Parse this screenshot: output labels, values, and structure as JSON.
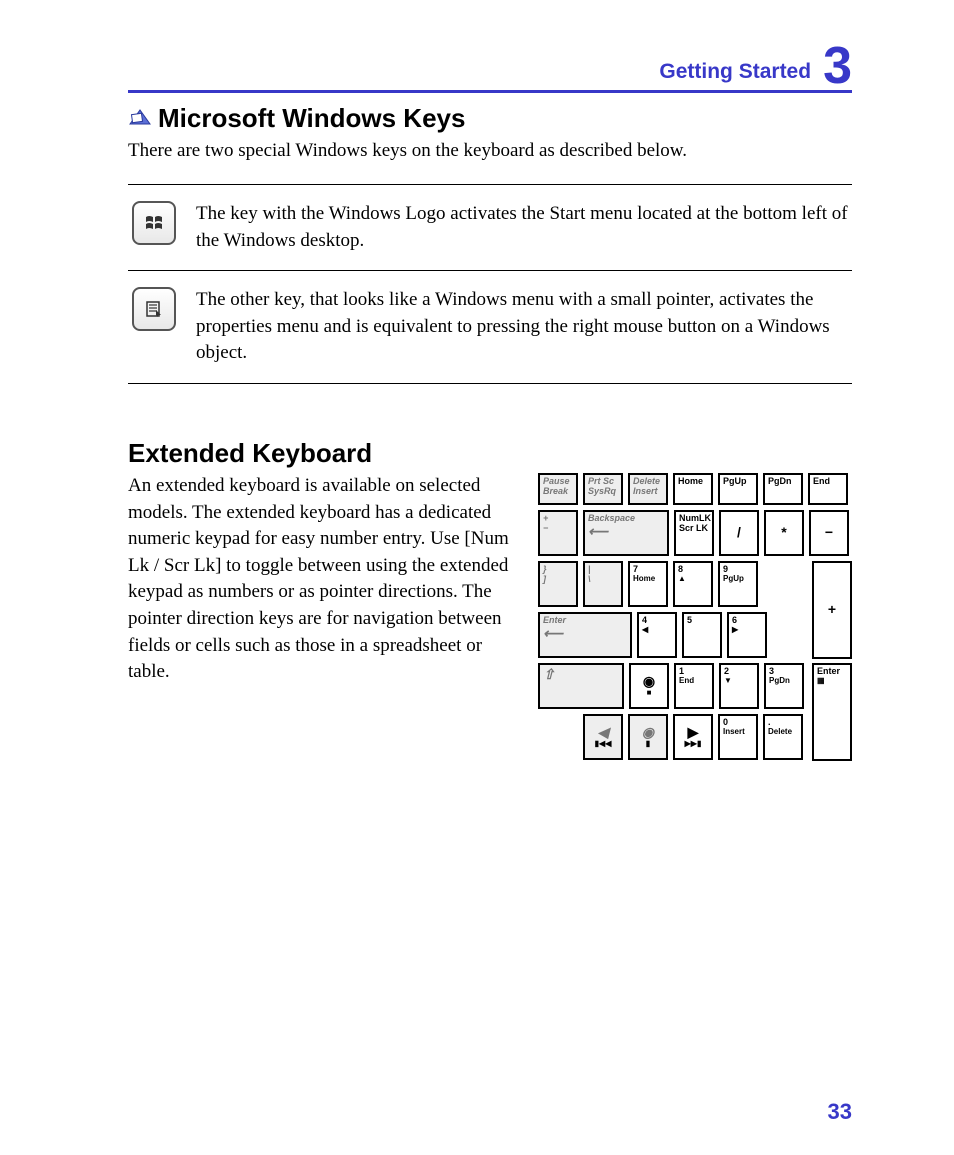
{
  "header": {
    "title": "Getting Started",
    "chapter": "3"
  },
  "section1": {
    "heading": "Microsoft Windows Keys",
    "intro": "There are two special Windows keys on the keyboard as described below.",
    "row1": "The key with the Windows Logo activates the Start menu located at the bottom left of the Windows desktop.",
    "row2": "The other key, that looks like a Windows menu with a small pointer, activates the properties menu and is equivalent to pressing the right mouse button on a Windows object."
  },
  "section2": {
    "heading": "Extended Keyboard",
    "body": "An extended keyboard is available on selected models. The extended keyboard has a dedicated numeric keypad for easy number entry. Use [Num Lk / Scr Lk] to toggle between using the extended keypad as numbers or as pointer directions. The pointer direction keys are for navigation between fields or cells such as those in a spreadsheet or table."
  },
  "kb": {
    "r0": {
      "pause": "Pause\nBreak",
      "prtsc": "Prt Sc\nSysRq",
      "del": "Delete\nInsert",
      "home": "Home",
      "pgup": "PgUp",
      "pgdn": "PgDn",
      "end": "End"
    },
    "r1": {
      "plus": "+",
      "minus": "−",
      "bksp": "Backspace",
      "numlk": "NumLK\nScr LK",
      "slash": "/",
      "star": "*",
      "dash": "−"
    },
    "r2": {
      "brace1": "}",
      "brace2": "]",
      "pipe1": "|",
      "pipe2": "\\",
      "n7": "7",
      "n7s": "Home",
      "n8": "8",
      "n8s": "▲",
      "n9": "9",
      "n9s": "PgUp"
    },
    "r3": {
      "enter": "Enter",
      "n4": "4",
      "n4s": "◀",
      "n5": "5",
      "n6": "6",
      "n6s": "▶",
      "plus2": "+"
    },
    "r4": {
      "shift": "⇧",
      "stop": "◉",
      "stopSub": "■",
      "n1": "1",
      "n1s": "End",
      "n2": "2",
      "n2s": "▼",
      "n3": "3",
      "n3s": "PgDn"
    },
    "r5": {
      "left": "◀",
      "leftSub": "▮◀◀",
      "down": "◉",
      "downSub": "▮",
      "right": "▶",
      "rightSub": "▶▶▮",
      "n0": "0",
      "n0s": "Insert",
      "dot": ".",
      "dots": "Delete",
      "enter2": "Enter",
      "enter2s": "▦"
    }
  },
  "pagenum": "33"
}
